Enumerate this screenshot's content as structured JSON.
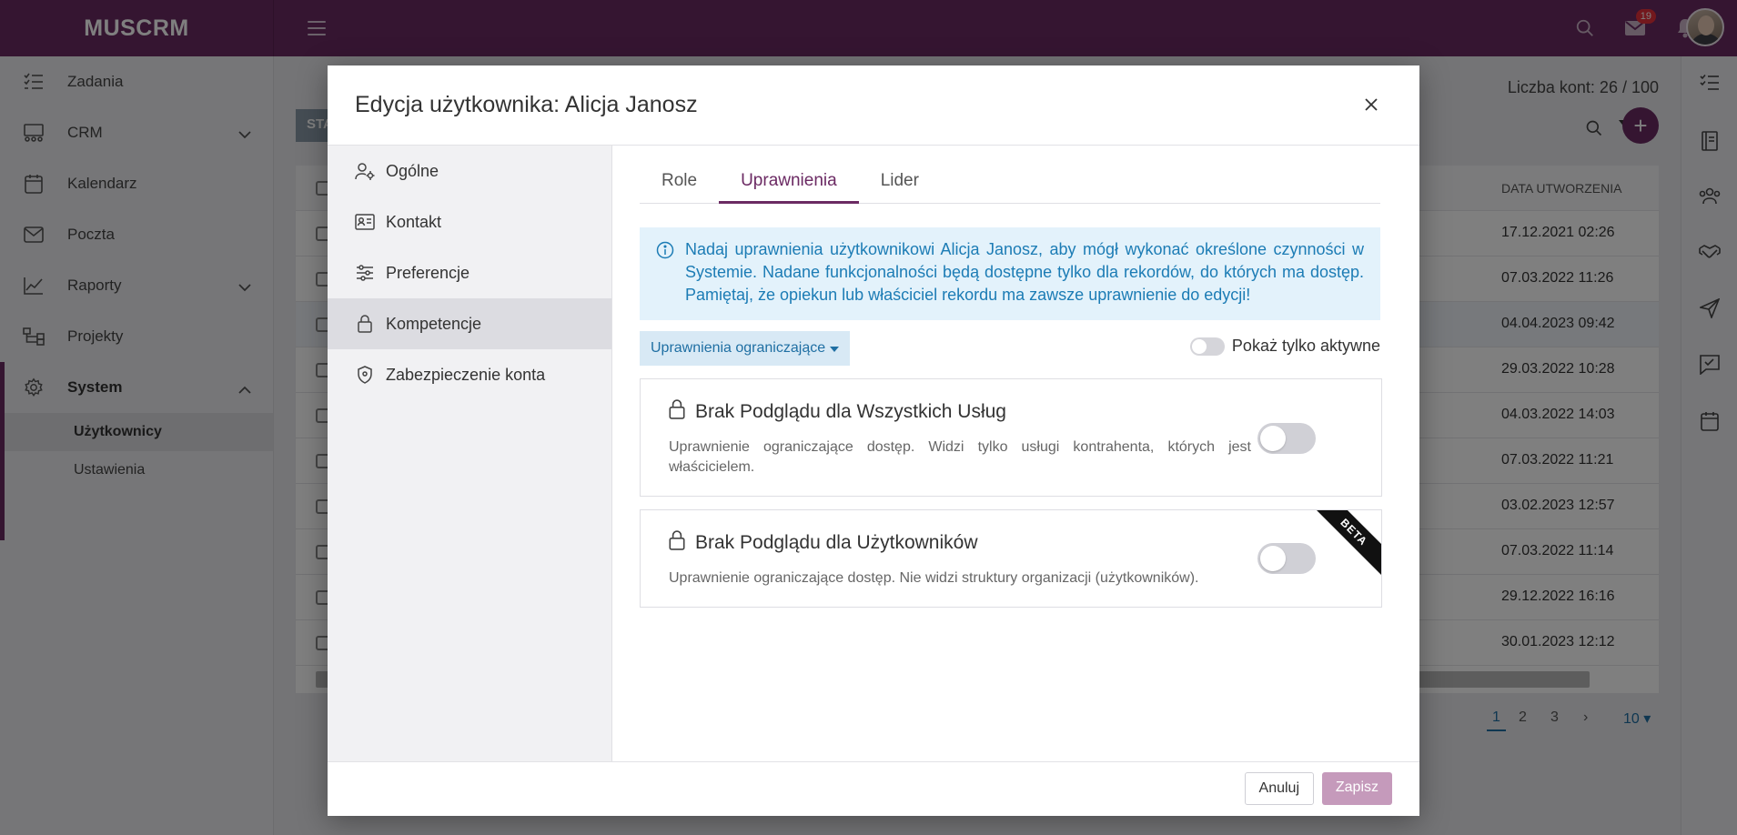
{
  "app": {
    "brand": "MUSCRM",
    "mail_count": "19"
  },
  "sidebar": {
    "items": [
      {
        "label": "Zadania",
        "icon": "tasks-icon"
      },
      {
        "label": "CRM",
        "icon": "crm-icon"
      },
      {
        "label": "Kalendarz",
        "icon": "calendar-icon"
      },
      {
        "label": "Poczta",
        "icon": "mail-icon"
      },
      {
        "label": "Raporty",
        "icon": "chart-icon"
      },
      {
        "label": "Projekty",
        "icon": "projects-icon"
      },
      {
        "label": "System",
        "icon": "gear-icon"
      }
    ],
    "sub_items": [
      "Użytkownicy",
      "Ustawienia"
    ]
  },
  "background": {
    "account_count": "Liczba kont: 26 / 100",
    "status_button": "STA",
    "date_column_header": "DATA UTWORZENIA",
    "dates": [
      "17.12.2021 02:26",
      "07.03.2022 11:26",
      "04.04.2023 09:42",
      "29.03.2022 10:28",
      "04.03.2022 14:03",
      "07.03.2022 11:21",
      "03.02.2023 12:57",
      "07.03.2022 11:14",
      "29.12.2022 16:16",
      "30.01.2023 12:12"
    ],
    "pages": [
      "1",
      "2",
      "3"
    ],
    "page_size": "10"
  },
  "modal": {
    "title": "Edycja użytkownika: Alicja Janosz",
    "nav": [
      {
        "label": "Ogólne",
        "icon": "user-gear-icon"
      },
      {
        "label": "Kontakt",
        "icon": "contact-card-icon"
      },
      {
        "label": "Preferencje",
        "icon": "sliders-icon"
      },
      {
        "label": "Kompetencje",
        "icon": "lock-icon"
      },
      {
        "label": "Zabezpieczenie konta",
        "icon": "shield-icon"
      }
    ],
    "tabs": [
      "Role",
      "Uprawnienia",
      "Lider"
    ],
    "info_text": "Nadaj uprawnienia użytkownikowi Alicja Janosz, aby mógł wykonać określone czynności w Systemie. Nadane funkcjonalności będą dostępne tylko dla rekordów, do których ma dostęp. Pamiętaj, że opiekun lub właściciel rekordu ma zawsze uprawnienie do edycji!",
    "filter_dropdown": "Uprawnienia ograniczające",
    "only_active_label": "Pokaż tylko aktywne",
    "permissions": [
      {
        "title": "Brak Podglądu dla Wszystkich Usług",
        "description": "Uprawnienie ograniczające dostęp. Widzi tylko usługi kontrahenta, których jest właścicielem.",
        "enabled": false
      },
      {
        "title": "Brak Podglądu dla Użytkowników",
        "description": "Uprawnienie ograniczające dostęp. Nie widzi struktury organizacji (użytkowników).",
        "enabled": false,
        "ribbon": "BETA"
      }
    ],
    "buttons": {
      "cancel": "Anuluj",
      "save": "Zapisz"
    }
  }
}
